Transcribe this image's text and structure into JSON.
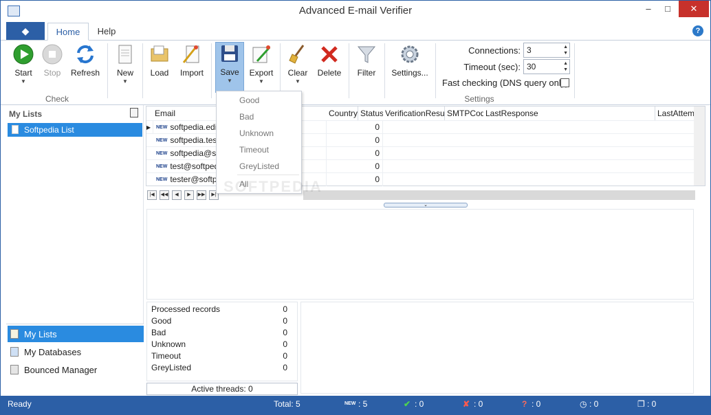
{
  "window": {
    "title": "Advanced E-mail Verifier",
    "minimize": "–",
    "maximize": "□",
    "close": "✕"
  },
  "tabs": {
    "app_menu": "◆",
    "home": "Home",
    "help": "Help",
    "help_icon": "?"
  },
  "ribbon": {
    "start": "Start",
    "stop": "Stop",
    "refresh": "Refresh",
    "new": "New",
    "load": "Load",
    "import": "Import",
    "save": "Save",
    "export": "Export",
    "clear": "Clear",
    "delete": "Delete",
    "filter": "Filter",
    "settings": "Settings...",
    "group_check": "Check",
    "group_settings": "Settings",
    "connections_label": "Connections:",
    "connections_value": "3",
    "timeout_label": "Timeout (sec):",
    "timeout_value": "30",
    "fast_checking_label": "Fast checking (DNS query only)"
  },
  "left_pane": {
    "header": "My Lists",
    "list_item": "Softpedia List"
  },
  "nav": {
    "my_lists": "My Lists",
    "my_databases": "My Databases",
    "bounced_manager": "Bounced Manager"
  },
  "grid": {
    "columns": [
      "Email",
      "Country",
      "Status",
      "VerificationResult",
      "SMTPCode",
      "LastResponse",
      "LastAttemp"
    ],
    "new_tag": "NEW",
    "rows": [
      {
        "email": "softpedia.edito",
        "status": "0"
      },
      {
        "email": "softpedia.test",
        "status": "0"
      },
      {
        "email": "softpedia@soft",
        "status": "0"
      },
      {
        "email": "test@softpedi",
        "status": "0"
      },
      {
        "email": "tester@softpe",
        "status": "0"
      }
    ]
  },
  "save_menu": {
    "items": [
      "Good",
      "Bad",
      "Unknown",
      "Timeout",
      "GreyListed"
    ],
    "all": "All"
  },
  "stats": {
    "rows": [
      {
        "label": "Processed records",
        "value": "0"
      },
      {
        "label": "Good",
        "value": "0"
      },
      {
        "label": "Bad",
        "value": "0"
      },
      {
        "label": "Unknown",
        "value": "0"
      },
      {
        "label": "Timeout",
        "value": "0"
      },
      {
        "label": "GreyListed",
        "value": "0"
      }
    ],
    "active_threads": "Active threads: 0"
  },
  "status_bar": {
    "ready": "Ready",
    "total": "Total: 5",
    "new_count": ": 5",
    "new_tag": "NEW",
    "good": ": 0",
    "bad": ": 0",
    "unknown": ": 0",
    "timeout": ": 0",
    "copies": ": 0"
  },
  "watermark": "SOFTPEDIA"
}
